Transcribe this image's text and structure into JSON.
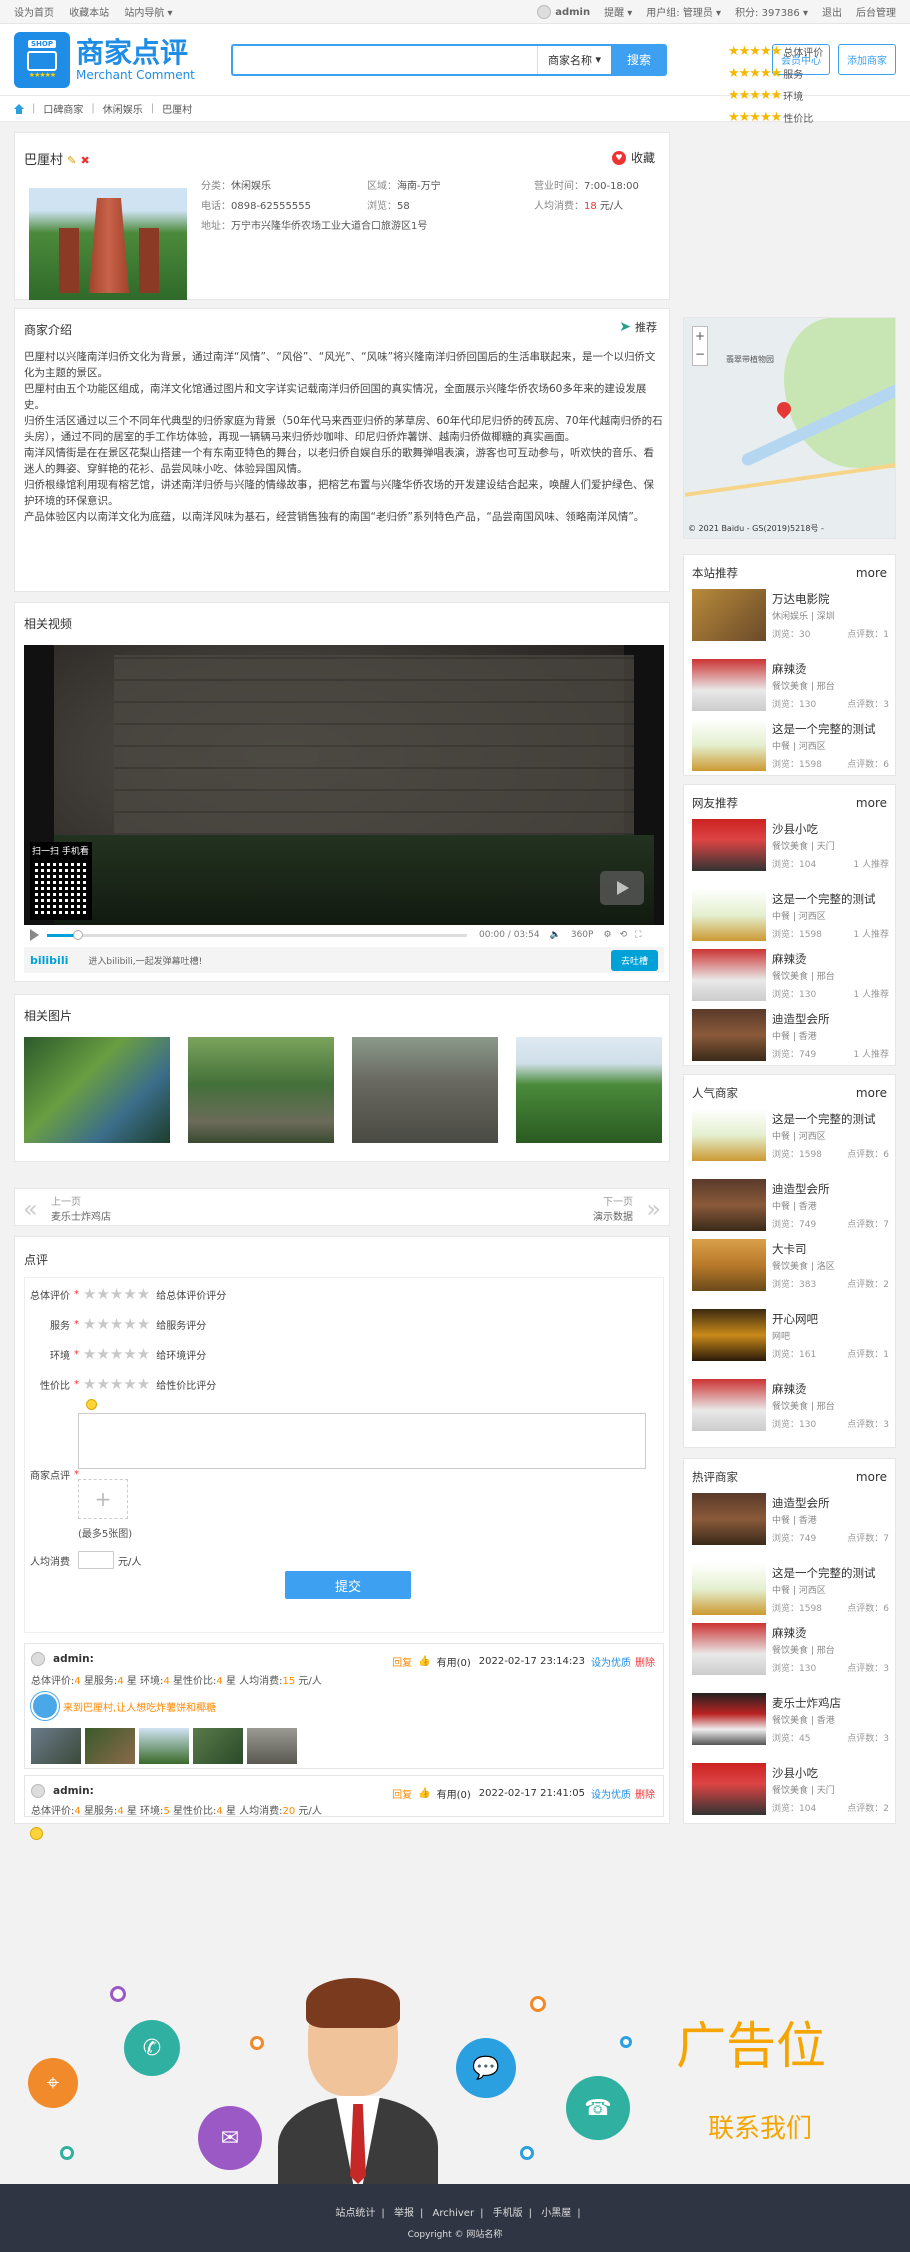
{
  "topbar": {
    "set_home": "设为首页",
    "bookmark": "收藏本站",
    "site_nav": "站内导航",
    "username": "admin",
    "remind": "提醒",
    "usergroup": "用户组: 管理员",
    "points": "积分: 397386",
    "logout": "退出",
    "admin_panel": "后台管理"
  },
  "header": {
    "logo_badge": "SHOP",
    "logo_cn": "商家点评",
    "logo_en": "Merchant Comment",
    "search_placeholder": "",
    "search_select": "商家名称",
    "search_button": "搜索",
    "member_center": "会员中心",
    "add_shop": "添加商家"
  },
  "breadcrumb": [
    "口碑商家",
    "休闲娱乐",
    "巴厘村"
  ],
  "shop": {
    "name": "巴厘村",
    "collect": "收藏",
    "category_k": "分类：",
    "category": "休闲娱乐",
    "area_k": "区域：",
    "area": "海南-万宁",
    "hours_k": "营业时间：",
    "hours": "7:00-18:00",
    "phone_k": "电话：",
    "phone": "0898-62555555",
    "views_k": "浏览：",
    "views": "58",
    "avg_k": "人均消费：",
    "avg": "18",
    "avg_unit": "元/人",
    "addr_k": "地址：",
    "addr": "万宁市兴隆华侨农场工业大道合口旅游区1号",
    "ratings": [
      "总体评价",
      "服务",
      "环境",
      "性价比"
    ]
  },
  "intro": {
    "title": "商家介绍",
    "recommend": "推荐",
    "paragraphs": [
      "巴厘村以兴隆南洋归侨文化为背景，通过南洋“风情”、“风俗”、“风光”、“风味”将兴隆南洋归侨回国后的生活串联起来，是一个以归侨文化为主题的景区。",
      "巴厘村由五个功能区组成，南洋文化馆通过图片和文字详实记载南洋归侨回国的真实情况，全面展示兴隆华侨农场60多年来的建设发展史。",
      "归侨生活区通过以三个不同年代典型的归侨家庭为背景（50年代马来西亚归侨的茅草房、60年代印尼归侨的砖瓦房、70年代越南归侨的石头房），通过不同的居室的手工作坊体验，再现一辆辆马来归侨炒咖啡、印尼归侨炸薯饼、越南归侨做椰糖的真实画面。",
      "南洋风情街是在在景区花梨山搭建一个有东南亚特色的舞台，以老归侨自娱自乐的歌舞弹唱表演，游客也可互动参与，听欢快的音乐、看迷人的舞姿、穿鲜艳的花衫、品尝风味小吃、体验异国风情。",
      "归侨根缘馆利用现有榕艺馆，讲述南洋归侨与兴隆的情缘故事，把榕艺布置与兴隆华侨农场的开发建设结合起来，唤醒人们爱护绿色、保护环境的环保意识。",
      "产品体验区内以南洋文化为底蕴，以南洋风味为基石，经营销售独有的南国“老归侨”系列特色产品，“品尝南国风味、领略南洋风情”。"
    ]
  },
  "video": {
    "title": "相关视频",
    "qr_label": "扫一扫 手机看",
    "time": "00:00 / 03:54",
    "quality": "360P",
    "brand": "bilibili",
    "danmaku_tip": "进入bilibili,一起发弹幕吐槽!",
    "danmaku_btn": "去吐槽"
  },
  "photos": {
    "title": "相关图片"
  },
  "prevnext": {
    "prev_label": "上一页",
    "prev_name": "麦乐士炸鸡店",
    "next_label": "下一页",
    "next_name": "演示数据"
  },
  "review_form": {
    "title": "点评",
    "rows": [
      {
        "label": "总体评价",
        "hint": "给总体评价评分"
      },
      {
        "label": "服务",
        "hint": "给服务评分"
      },
      {
        "label": "环境",
        "hint": "给环境评分"
      },
      {
        "label": "性价比",
        "hint": "给性价比评分"
      }
    ],
    "comment_label": "商家点评",
    "upload_hint": "(最多5张图)",
    "avg_label": "人均消费",
    "avg_unit": "元/人",
    "submit": "提交"
  },
  "reviews": [
    {
      "user": "admin:",
      "reply": "回复",
      "useful": "有用(0)",
      "time": "2022-02-17 23:14:23",
      "set_best": "设为优质",
      "delete": "删除",
      "overall": "4",
      "service": "4",
      "env": "4",
      "value": "4",
      "avg": "15",
      "text": "来到巴厘村,让人想吃炸薯饼和椰糖"
    },
    {
      "user": "admin:",
      "reply": "回复",
      "useful": "有用(0)",
      "time": "2022-02-17 21:41:05",
      "set_best": "设为优质",
      "delete": "删除",
      "overall": "4",
      "service": "4",
      "env": "5",
      "value": "4",
      "avg": "20",
      "text": ""
    }
  ],
  "review_labels": {
    "overall": "总体评价:",
    "service": "星服务:",
    "env": "星 环境:",
    "value": "星性价比:",
    "avg": "星 人均消费:",
    "unit": "元/人"
  },
  "map": {
    "label": "翡翠带植物园",
    "copyright": "© 2021 Baidu - GS(2019)5218号 -"
  },
  "side_sections": [
    {
      "title": "本站推荐",
      "more": "more",
      "items": [
        {
          "name": "万达电影院",
          "cat": "休闲娱乐 | 深圳",
          "views": "浏览：30",
          "extra": "点评数：1"
        },
        {
          "name": "麻辣烫",
          "cat": "餐饮美食 | 邢台",
          "views": "浏览：130",
          "extra": "点评数：3"
        },
        {
          "name": "这是一个完整的测试",
          "cat": "中餐 | 河西区",
          "views": "浏览：1598",
          "extra": "点评数：6"
        }
      ]
    },
    {
      "title": "网友推荐",
      "more": "more",
      "items": [
        {
          "name": "沙县小吃",
          "cat": "餐饮美食 | 天门",
          "views": "浏览：104",
          "extra": "1 人推荐"
        },
        {
          "name": "这是一个完整的测试",
          "cat": "中餐 | 河西区",
          "views": "浏览：1598",
          "extra": "1 人推荐"
        },
        {
          "name": "麻辣烫",
          "cat": "餐饮美食 | 邢台",
          "views": "浏览：130",
          "extra": "1 人推荐"
        },
        {
          "name": "迪造型会所",
          "cat": "中餐 | 香港",
          "views": "浏览：749",
          "extra": "1 人推荐"
        }
      ]
    },
    {
      "title": "人气商家",
      "more": "more",
      "items": [
        {
          "name": "这是一个完整的测试",
          "cat": "中餐 | 河西区",
          "views": "浏览：1598",
          "extra": "点评数：6"
        },
        {
          "name": "迪造型会所",
          "cat": "中餐 | 香港",
          "views": "浏览：749",
          "extra": "点评数：7"
        },
        {
          "name": "大卡司",
          "cat": "餐饮美食 | 洛区",
          "views": "浏览：383",
          "extra": "点评数：2"
        },
        {
          "name": "开心网吧",
          "cat": "网吧",
          "views": "浏览：161",
          "extra": "点评数：1"
        },
        {
          "name": "麻辣烫",
          "cat": "餐饮美食 | 邢台",
          "views": "浏览：130",
          "extra": "点评数：3"
        }
      ]
    },
    {
      "title": "热评商家",
      "more": "more",
      "items": [
        {
          "name": "迪造型会所",
          "cat": "中餐 | 香港",
          "views": "浏览：749",
          "extra": "点评数：7"
        },
        {
          "name": "这是一个完整的测试",
          "cat": "中餐 | 河西区",
          "views": "浏览：1598",
          "extra": "点评数：6"
        },
        {
          "name": "麻辣烫",
          "cat": "餐饮美食 | 邢台",
          "views": "浏览：130",
          "extra": "点评数：3"
        },
        {
          "name": "麦乐士炸鸡店",
          "cat": "餐饮美食 | 香港",
          "views": "浏览：45",
          "extra": "点评数：3"
        },
        {
          "name": "沙县小吃",
          "cat": "餐饮美食 | 天门",
          "views": "浏览：104",
          "extra": "点评数：2"
        }
      ]
    }
  ],
  "ad": {
    "title": "广告位",
    "sub": "联系我们"
  },
  "footer": {
    "links": [
      "站点统计",
      "举报",
      "Archiver",
      "手机版",
      "小黑屋"
    ],
    "copyright": "Copyright © 网站名称"
  }
}
